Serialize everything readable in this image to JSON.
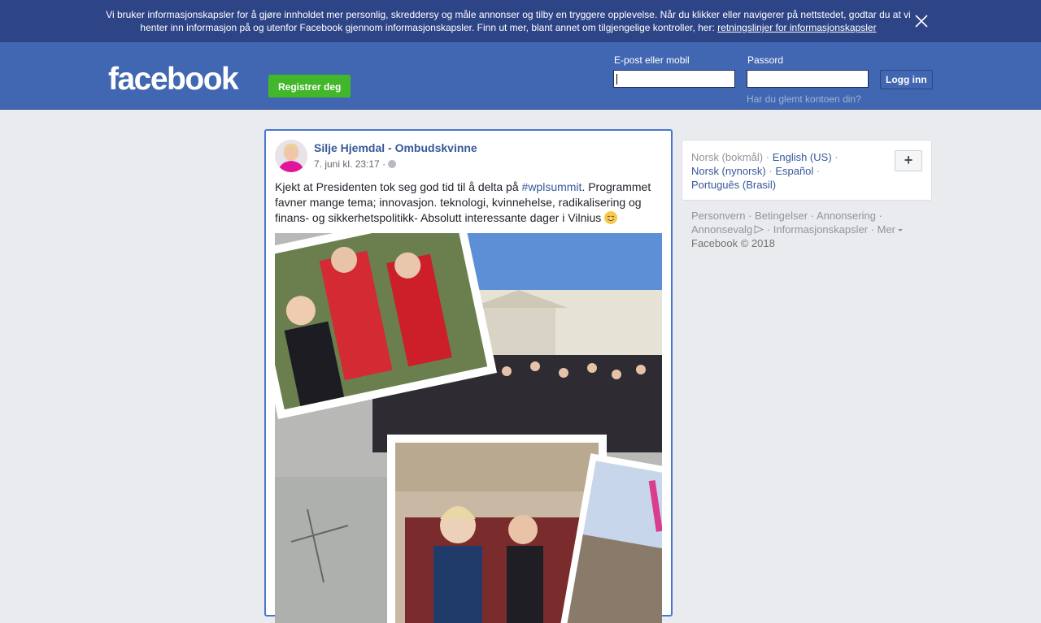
{
  "cookie_banner": {
    "text": "Vi bruker informasjonskapsler for å gjøre innholdet mer personlig, skreddersy og måle annonser og tilby en tryggere opplevelse. Når du klikker eller navigerer på nettstedet, godtar du at vi henter inn informasjon på og utenfor Facebook gjennom informasjonskapsler. Finn ut mer, blant annet om tilgjengelige kontroller, her: ",
    "link": "retningslinjer for informasjonskapsler",
    "close_icon": "close-icon"
  },
  "header": {
    "logo": "facebook",
    "register_label": "Registrer deg",
    "email_label": "E-post eller mobil",
    "password_label": "Passord",
    "login_label": "Logg inn",
    "forgot_link": "Har du glemt kontoen din?",
    "email_value": "",
    "password_value": ""
  },
  "post": {
    "author": "Silje Hjemdal - Ombudskvinne",
    "date": "7. juni kl. 23:17",
    "separator": "·",
    "privacy_icon": "globe-icon",
    "text_before": "Kjekt at Presidenten tok seg god tid til å delta på ",
    "hashtag": "#wplsummit",
    "text_after": ". Programmet favner mange tema; innovasjon. teknologi, kvinnehelse, radikalisering og finans- og sikkerhetspolitikk- Absolutt interessante dager i Vilnius",
    "emoji": "smiling-face-emoji"
  },
  "languages": {
    "current": "Norsk (bokmål)",
    "options": [
      "English (US)",
      "Norsk (nynorsk)",
      "Español",
      "Português (Brasil)"
    ],
    "more_label": "+"
  },
  "footer": {
    "links": [
      "Personvern",
      "Betingelser",
      "Annonsering",
      "Annonsevalg",
      "Informasjonskapsler",
      "Mer"
    ],
    "copyright": "Facebook © 2018"
  },
  "colors": {
    "banner": "#2d4486",
    "header": "#4267b2",
    "register": "#42b72a",
    "link": "#365899",
    "page_bg": "#e9ebee"
  }
}
